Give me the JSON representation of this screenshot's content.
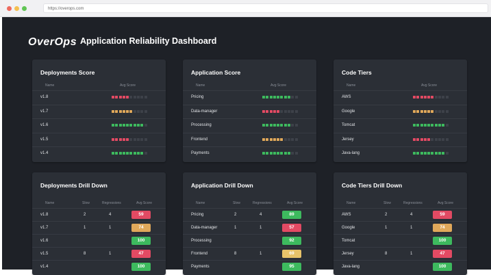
{
  "browser": {
    "url": "https://overops.com"
  },
  "header": {
    "logo": "OverOps",
    "title": "Application Reliability Dashboard"
  },
  "colors": {
    "green": "#3dba5e",
    "red": "#e24a63",
    "orange": "#e0a85a",
    "yellow": "#e8c36a",
    "background": "#1e2127",
    "card": "#2b2f36"
  },
  "score_cards": [
    {
      "title": "Deployments Score",
      "col_name": "Name",
      "col_score": "Avg Score",
      "rows": [
        {
          "name": "v1.8",
          "filled": 5,
          "color": "red"
        },
        {
          "name": "v1.7",
          "filled": 6,
          "color": "orange"
        },
        {
          "name": "v1.6",
          "filled": 9,
          "color": "green"
        },
        {
          "name": "v1.5",
          "filled": 5,
          "color": "red"
        },
        {
          "name": "v1.4",
          "filled": 9,
          "color": "green"
        }
      ]
    },
    {
      "title": "Application Score",
      "col_name": "Name",
      "col_score": "Avg Score",
      "rows": [
        {
          "name": "Pricing",
          "filled": 8,
          "color": "green"
        },
        {
          "name": "Data-manager",
          "filled": 5,
          "color": "red"
        },
        {
          "name": "Processing",
          "filled": 8,
          "color": "green"
        },
        {
          "name": "Frontend",
          "filled": 6,
          "color": "orange"
        },
        {
          "name": "Payments",
          "filled": 8,
          "color": "green"
        }
      ]
    },
    {
      "title": "Code Tiers",
      "col_name": "Name",
      "col_score": "Avg Score",
      "rows": [
        {
          "name": "AWS",
          "filled": 6,
          "color": "red"
        },
        {
          "name": "Google",
          "filled": 6,
          "color": "orange"
        },
        {
          "name": "Tomcat",
          "filled": 9,
          "color": "green"
        },
        {
          "name": "Jersey",
          "filled": 5,
          "color": "red"
        },
        {
          "name": "Java-lang",
          "filled": 9,
          "color": "green"
        }
      ]
    }
  ],
  "drill_cards": [
    {
      "title": "Deployments Drill Down",
      "cols": [
        "Name",
        "Slow",
        "Regressions",
        "Avg Score"
      ],
      "rows": [
        {
          "name": "v1.8",
          "slow": "2",
          "reg": "4",
          "score": "59",
          "color": "red"
        },
        {
          "name": "v1.7",
          "slow": "1",
          "reg": "1",
          "score": "74",
          "color": "orange"
        },
        {
          "name": "v1.6",
          "slow": "",
          "reg": "",
          "score": "100",
          "color": "green"
        },
        {
          "name": "v1.5",
          "slow": "8",
          "reg": "1",
          "score": "47",
          "color": "red"
        },
        {
          "name": "v1.4",
          "slow": "",
          "reg": "",
          "score": "100",
          "color": "green"
        }
      ]
    },
    {
      "title": "Application Drill Down",
      "cols": [
        "Name",
        "Slow",
        "Regressions",
        "Avg Score"
      ],
      "rows": [
        {
          "name": "Pricing",
          "slow": "2",
          "reg": "4",
          "score": "89",
          "color": "green"
        },
        {
          "name": "Data-manager",
          "slow": "1",
          "reg": "1",
          "score": "57",
          "color": "red"
        },
        {
          "name": "Processing",
          "slow": "",
          "reg": "",
          "score": "92",
          "color": "green"
        },
        {
          "name": "Frontend",
          "slow": "8",
          "reg": "1",
          "score": "69",
          "color": "yellow"
        },
        {
          "name": "Payments",
          "slow": "",
          "reg": "",
          "score": "95",
          "color": "green"
        }
      ]
    },
    {
      "title": "Code Tiers Drill Down",
      "cols": [
        "Name",
        "Slow",
        "Regressions",
        "Avg Score"
      ],
      "rows": [
        {
          "name": "AWS",
          "slow": "2",
          "reg": "4",
          "score": "59",
          "color": "red"
        },
        {
          "name": "Google",
          "slow": "1",
          "reg": "1",
          "score": "74",
          "color": "orange"
        },
        {
          "name": "Tomcat",
          "slow": "",
          "reg": "",
          "score": "100",
          "color": "green"
        },
        {
          "name": "Jersey",
          "slow": "8",
          "reg": "1",
          "score": "47",
          "color": "red"
        },
        {
          "name": "Java-lang",
          "slow": "",
          "reg": "",
          "score": "100",
          "color": "green"
        }
      ]
    }
  ]
}
